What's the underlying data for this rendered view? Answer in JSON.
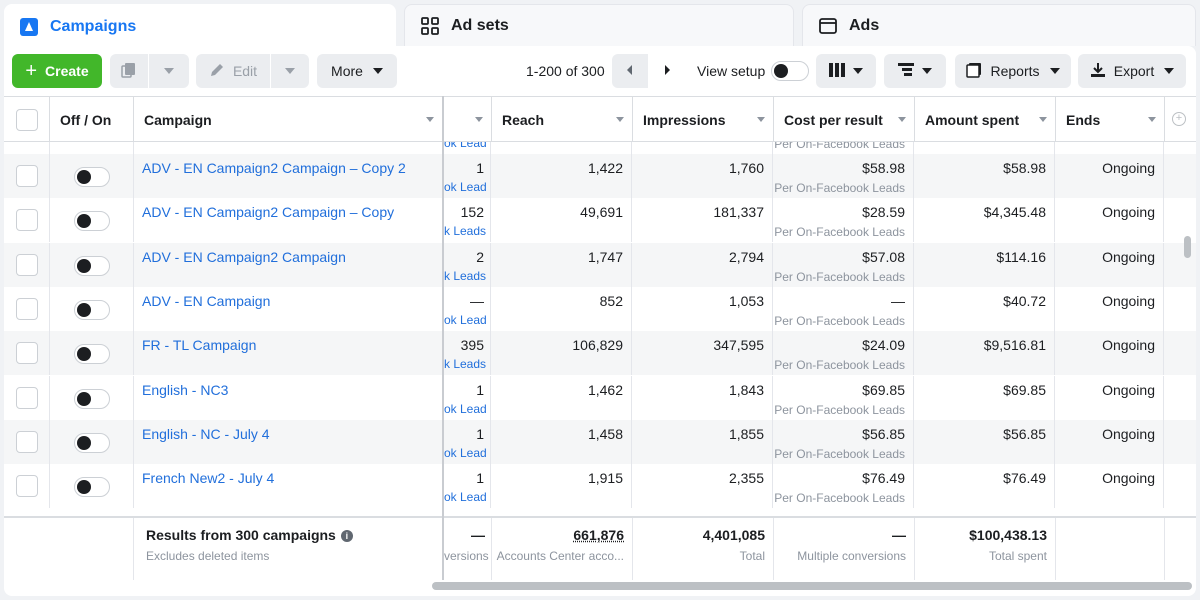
{
  "tabs": [
    {
      "label": "Campaigns",
      "icon": "campaign-flag-icon"
    },
    {
      "label": "Ad sets",
      "icon": "grid-icon"
    },
    {
      "label": "Ads",
      "icon": "ad-window-icon"
    }
  ],
  "toolbar": {
    "create_label": "Create",
    "edit_label": "Edit",
    "more_label": "More",
    "pager": "1-200 of 300",
    "view_setup": "View setup",
    "reports_label": "Reports",
    "export_label": "Export"
  },
  "columns": {
    "off_on": "Off / On",
    "campaign": "Campaign",
    "reach": "Reach",
    "impressions": "Impressions",
    "cost_per_result": "Cost per result",
    "amount_spent": "Amount spent",
    "ends": "Ends"
  },
  "partial_top_row": {
    "results_sub": "ok Lead",
    "cpr_sub": "Per On-Facebook Leads"
  },
  "rows": [
    {
      "name": "ADV - EN Campaign2 Campaign – Copy 2",
      "results": "1",
      "results_sub": "ok Lead",
      "reach": "1,422",
      "impressions": "1,760",
      "cpr": "$58.98",
      "cpr_sub": "Per On-Facebook Leads",
      "amount": "$58.98",
      "ends": "Ongoing"
    },
    {
      "name": "ADV - EN Campaign2 Campaign – Copy",
      "results": "152",
      "results_sub": "k Leads",
      "reach": "49,691",
      "impressions": "181,337",
      "cpr": "$28.59",
      "cpr_sub": "Per On-Facebook Leads",
      "amount": "$4,345.48",
      "ends": "Ongoing"
    },
    {
      "name": "ADV - EN Campaign2 Campaign",
      "results": "2",
      "results_sub": "k Leads",
      "reach": "1,747",
      "impressions": "2,794",
      "cpr": "$57.08",
      "cpr_sub": "Per On-Facebook Leads",
      "amount": "$114.16",
      "ends": "Ongoing"
    },
    {
      "name": "ADV - EN Campaign",
      "results": "—",
      "results_sub": "ok Lead",
      "reach": "852",
      "impressions": "1,053",
      "cpr": "—",
      "cpr_sub": "Per On-Facebook Leads",
      "amount": "$40.72",
      "ends": "Ongoing"
    },
    {
      "name": "FR - TL Campaign",
      "results": "395",
      "results_sub": "k Leads",
      "reach": "106,829",
      "impressions": "347,595",
      "cpr": "$24.09",
      "cpr_sub": "Per On-Facebook Leads",
      "amount": "$9,516.81",
      "ends": "Ongoing"
    },
    {
      "name": "English - NC3",
      "results": "1",
      "results_sub": "ok Lead",
      "reach": "1,462",
      "impressions": "1,843",
      "cpr": "$69.85",
      "cpr_sub": "Per On-Facebook Leads",
      "amount": "$69.85",
      "ends": "Ongoing"
    },
    {
      "name": "English - NC - July 4",
      "results": "1",
      "results_sub": "ok Lead",
      "reach": "1,458",
      "impressions": "1,855",
      "cpr": "$56.85",
      "cpr_sub": "Per On-Facebook Leads",
      "amount": "$56.85",
      "ends": "Ongoing"
    },
    {
      "name": "French New2 - July 4",
      "results": "1",
      "results_sub": "ok Lead",
      "reach": "1,915",
      "impressions": "2,355",
      "cpr": "$76.49",
      "cpr_sub": "Per On-Facebook Leads",
      "amount": "$76.49",
      "ends": "Ongoing"
    }
  ],
  "summary": {
    "title": "Results from 300 campaigns",
    "subtitle": "Excludes deleted items",
    "results": "—",
    "results_sub": "versions",
    "reach": "661,876",
    "reach_sub": "Accounts Center acco...",
    "impressions": "4,401,085",
    "impressions_sub": "Total",
    "cpr": "—",
    "cpr_sub": "Multiple conversions",
    "amount": "$100,438.13",
    "amount_sub": "Total spent"
  },
  "colors": {
    "accent": "#1877f2",
    "create": "#42b72a",
    "link": "#216fdb"
  }
}
